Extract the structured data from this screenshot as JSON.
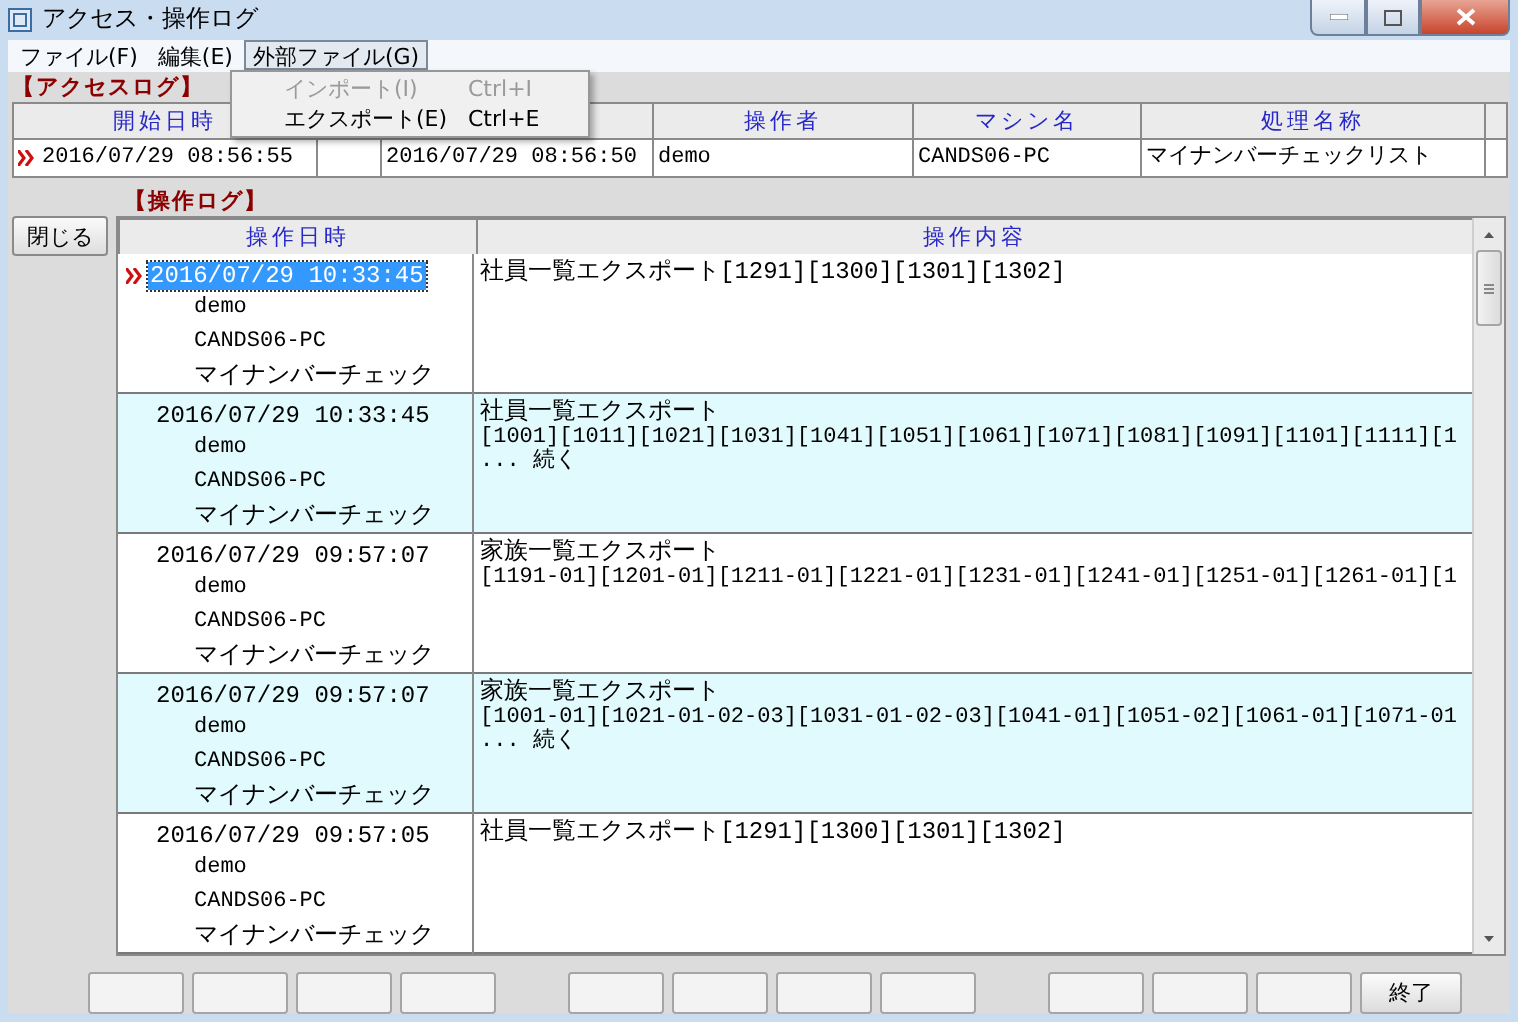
{
  "window": {
    "title": "アクセス・操作ログ"
  },
  "menu": [
    {
      "label": "ファイル(F)",
      "open": false
    },
    {
      "label": "編集(E)",
      "open": false
    },
    {
      "label": "外部ファイル(G)",
      "open": true
    }
  ],
  "dropdown": {
    "items": [
      {
        "label": "インポート(I)",
        "shortcut": "Ctrl+I",
        "disabled": true
      },
      {
        "label": "エクスポート(E)",
        "shortcut": "Ctrl+E",
        "disabled": false
      }
    ]
  },
  "access_log": {
    "title": "【アクセスログ】",
    "columns": [
      {
        "label": "開始日時"
      },
      {
        "kind": "covered"
      },
      {
        "kind": "blank"
      },
      {
        "label": "操作者"
      },
      {
        "label": "マシン名"
      },
      {
        "label": "処理名称"
      },
      {
        "kind": "blank"
      }
    ],
    "rows": [
      {
        "selected": true,
        "start": "2016/07/29 08:56:55",
        "column_3": "2016/07/29 08:56:50",
        "user": "demo",
        "machine": "CANDS06-PC",
        "process": "マイナンバーチェックリスト"
      }
    ]
  },
  "operation_log": {
    "title": "【操作ログ】",
    "close_button": "閉じる",
    "columns": [
      "操作日時",
      "操作内容"
    ],
    "rows": [
      {
        "selected": true,
        "date": "2016/07/29 10:33:45",
        "user": "demo",
        "machine": "CANDS06-PC",
        "process": "マイナンバーチェック",
        "content": [
          "社員一覧エクスポート[1291][1300][1301][1302]"
        ]
      },
      {
        "selected": false,
        "date": "2016/07/29 10:33:45",
        "user": "demo",
        "machine": "CANDS06-PC",
        "process": "マイナンバーチェック",
        "content": [
          "社員一覧エクスポート",
          "[1001][1011][1021][1031][1041][1051][1061][1071][1081][1091][1101][1111][1",
          "... 続く"
        ]
      },
      {
        "selected": false,
        "date": "2016/07/29 09:57:07",
        "user": "demo",
        "machine": "CANDS06-PC",
        "process": "マイナンバーチェック",
        "content": [
          "家族一覧エクスポート",
          "[1191-01][1201-01][1211-01][1221-01][1231-01][1241-01][1251-01][1261-01][1"
        ]
      },
      {
        "selected": false,
        "date": "2016/07/29 09:57:07",
        "user": "demo",
        "machine": "CANDS06-PC",
        "process": "マイナンバーチェック",
        "content": [
          "家族一覧エクスポート",
          "[1001-01][1021-01-02-03][1031-01-02-03][1041-01][1051-02][1061-01][1071-01",
          "... 続く"
        ]
      },
      {
        "selected": false,
        "date": "2016/07/29 09:57:05",
        "user": "demo",
        "machine": "CANDS06-PC",
        "process": "マイナンバーチェック",
        "content": [
          "社員一覧エクスポート[1291][1300][1301][1302]"
        ]
      }
    ]
  },
  "footer": {
    "groups": [
      [
        {
          "kind": "blank"
        },
        {
          "kind": "blank"
        },
        {
          "kind": "blank"
        },
        {
          "kind": "blank"
        }
      ],
      [
        {
          "kind": "blank"
        },
        {
          "kind": "blank"
        },
        {
          "kind": "blank"
        },
        {
          "kind": "blank"
        }
      ],
      [
        {
          "kind": "blank"
        },
        {
          "kind": "blank"
        },
        {
          "kind": "blank"
        },
        {
          "kind": "labeled",
          "label": "終了"
        }
      ]
    ]
  }
}
